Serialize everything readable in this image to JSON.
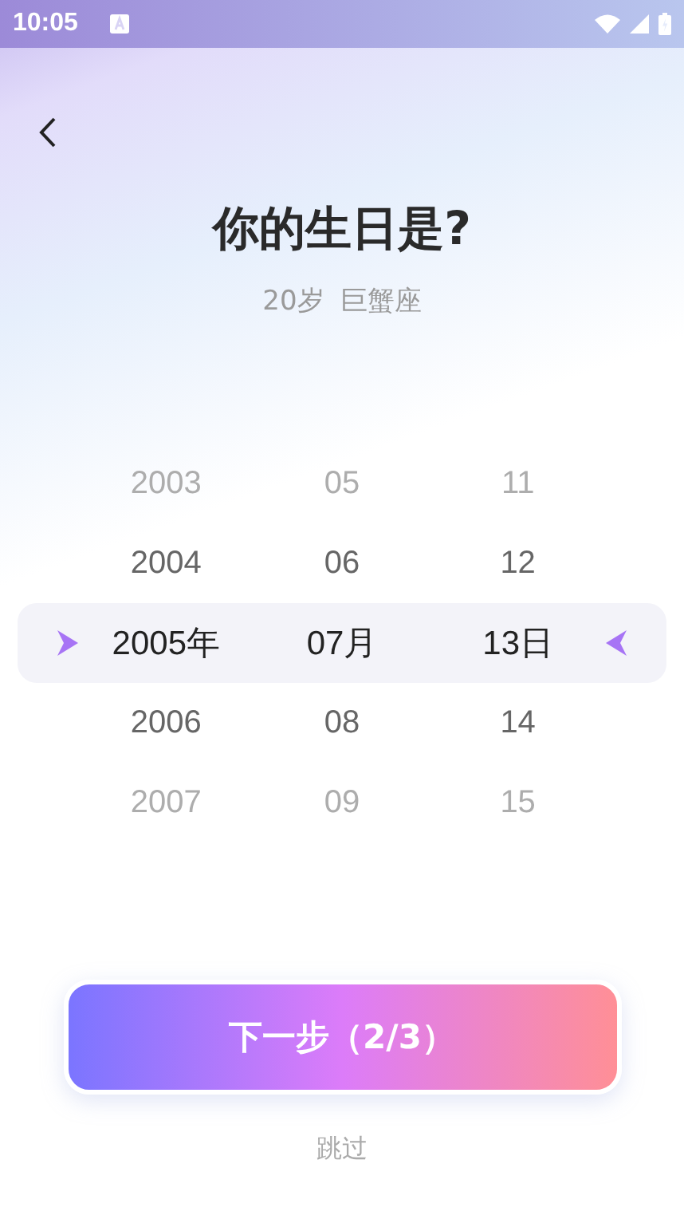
{
  "status_bar": {
    "time": "10:05"
  },
  "title": "你的生日是?",
  "subtitle": [
    "20岁",
    "巨蟹座"
  ],
  "picker": {
    "rows": [
      {
        "kind": "faded",
        "cells": [
          "2003",
          "05",
          "11"
        ]
      },
      {
        "kind": "normal",
        "cells": [
          "2004",
          "06",
          "12"
        ]
      },
      {
        "kind": "selected",
        "cells": [
          "2005年",
          "07月",
          "13日"
        ]
      },
      {
        "kind": "normal",
        "cells": [
          "2006",
          "08",
          "14"
        ]
      },
      {
        "kind": "faded",
        "cells": [
          "2007",
          "09",
          "15"
        ]
      }
    ]
  },
  "next_button": "下一步（2/3）",
  "skip_link": "跳过"
}
